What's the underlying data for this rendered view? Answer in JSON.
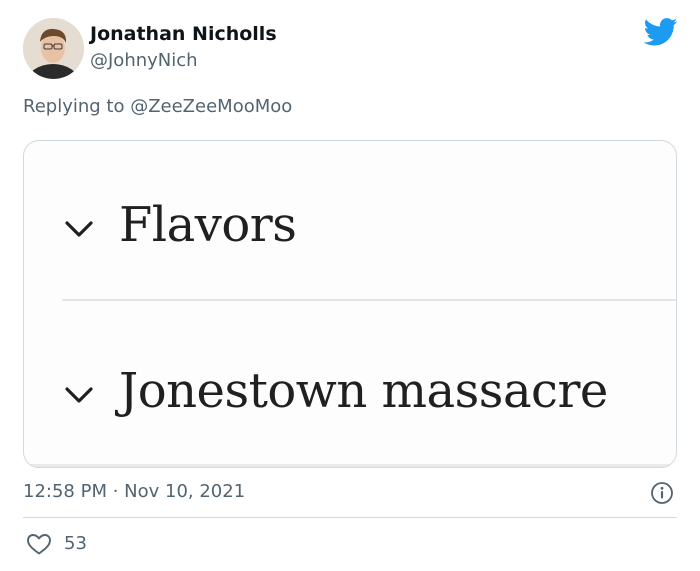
{
  "author": {
    "name": "Jonathan Nicholls",
    "handle": "@JohnyNich"
  },
  "reply": {
    "text": "Replying to @ZeeZeeMooMoo"
  },
  "media": {
    "items": [
      {
        "label": "Flavors"
      },
      {
        "label": "Jonestown massacre"
      }
    ]
  },
  "meta": {
    "timestamp": "12:58 PM · Nov 10, 2021"
  },
  "engagement": {
    "likes": "53"
  },
  "colors": {
    "twitter_blue": "#1d9bf0",
    "secondary_text": "#536471",
    "primary_text": "#0f1419"
  },
  "icons": [
    "twitter-bird-icon",
    "chevron-down-icon",
    "info-icon",
    "heart-icon"
  ]
}
